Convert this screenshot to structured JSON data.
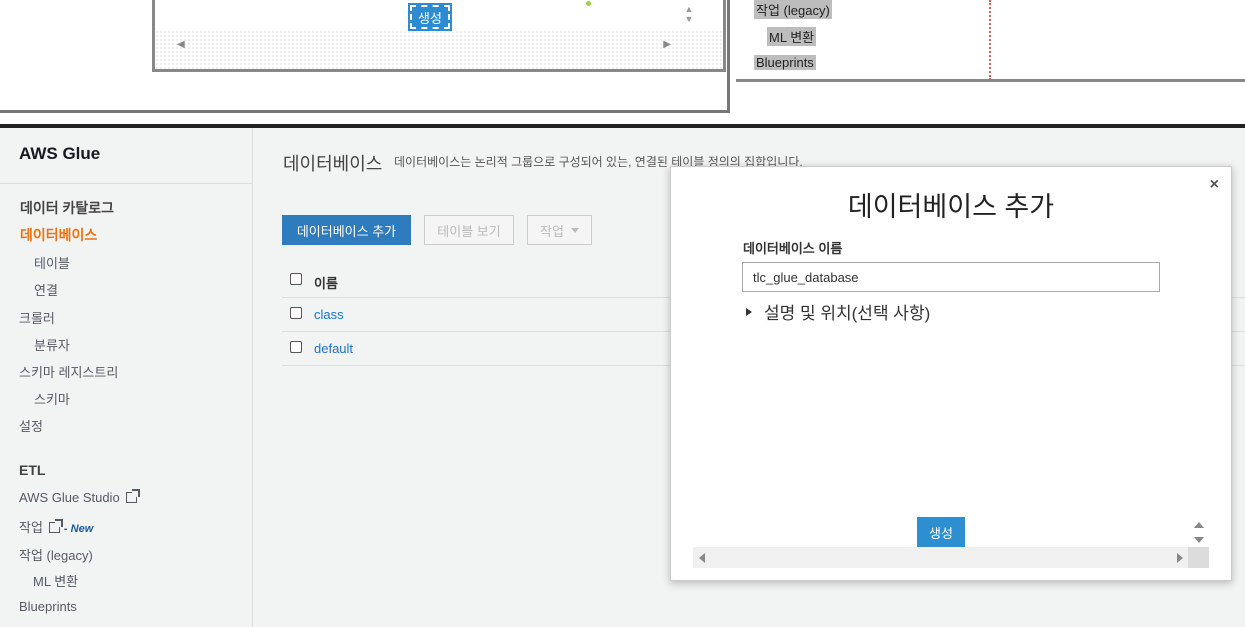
{
  "top_preview": {
    "create_label": "생성",
    "items": [
      "작업 (legacy)",
      "ML 변환",
      "Blueprints"
    ]
  },
  "sidebar": {
    "title": "AWS Glue",
    "data_catalog": "데이터 카탈로그",
    "databases": "데이터베이스",
    "tables": "테이블",
    "connections": "연결",
    "crawlers": "크롤러",
    "classifiers": "분류자",
    "schema_registry": "스키마 레지스트리",
    "schemas": "스키마",
    "settings": "설정",
    "etl": "ETL",
    "glue_studio": "AWS Glue Studio",
    "jobs": "작업",
    "jobs_new": "- New",
    "jobs_legacy": "작업 (legacy)",
    "ml_transforms": "ML 변환",
    "blueprints": "Blueprints"
  },
  "main": {
    "title": "데이터베이스",
    "description": "데이터베이스는 논리적 그룹으로 구성되어 있는, 연결된 테이블 정의의 집합입니다.",
    "add_database_button": "데이터베이스 추가",
    "view_tables_button": "테이블 보기",
    "action_button": "작업",
    "column_name": "이름",
    "rows": [
      "class",
      "default"
    ]
  },
  "modal": {
    "title": "데이터베이스 추가",
    "close": "×",
    "name_label": "데이터베이스 이름",
    "name_value": "tlc_glue_database",
    "expander_label": "설명 및 위치(선택 사항)",
    "create_button": "생성"
  },
  "colors": {
    "primary": "#2e7bbd",
    "active_nav": "#ec7211",
    "link": "#1a73c8"
  }
}
